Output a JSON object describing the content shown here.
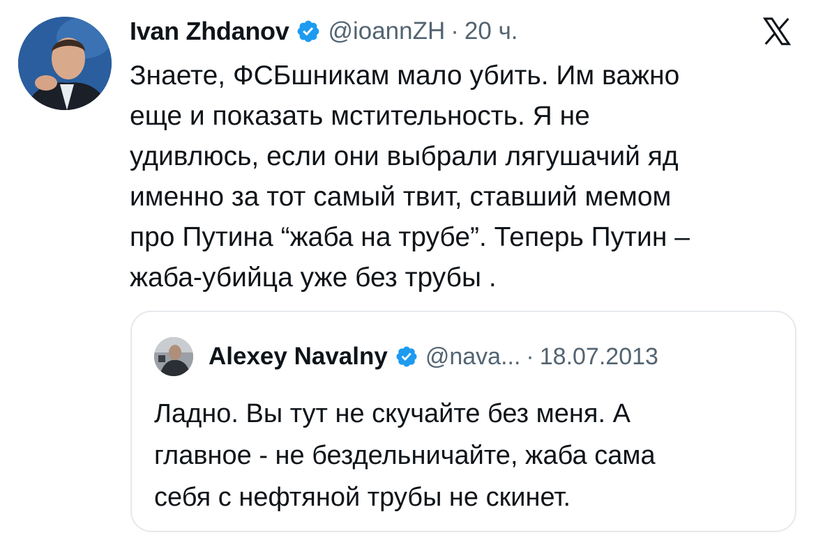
{
  "tweet": {
    "author_name": "Ivan Zhdanov",
    "author_handle": "@ioannZH",
    "separator": "·",
    "time": "20 ч.",
    "verified": true,
    "text_lines": [
      "Знаете, ФСБшникам мало убить. Им важно",
      "еще и показать мстительность. Я не",
      "удивлюсь, если они выбрали лягушачий яд",
      "именно за тот самый твит, ставший мемом",
      "про Путина “жаба на трубе”. Теперь Путин –",
      "жаба-убийца уже без трубы ."
    ]
  },
  "quote": {
    "author_name": "Alexey Navalny",
    "author_handle": "@nava...",
    "separator": "·",
    "date": "18.07.2013",
    "verified": true,
    "text_lines": [
      "Ладно. Вы тут не скучайте без меня. А",
      "главное - не бездельничайте, жаба сама",
      "себя с нефтяной трубы не скинет."
    ]
  },
  "icons": {
    "verified_badge": "verified-badge-icon",
    "brand": "x-logo-icon"
  },
  "colors": {
    "verified_blue": "#1d9bf0",
    "secondary_text": "#536471",
    "border": "#e6e9ec",
    "primary_text": "#0f1419"
  }
}
